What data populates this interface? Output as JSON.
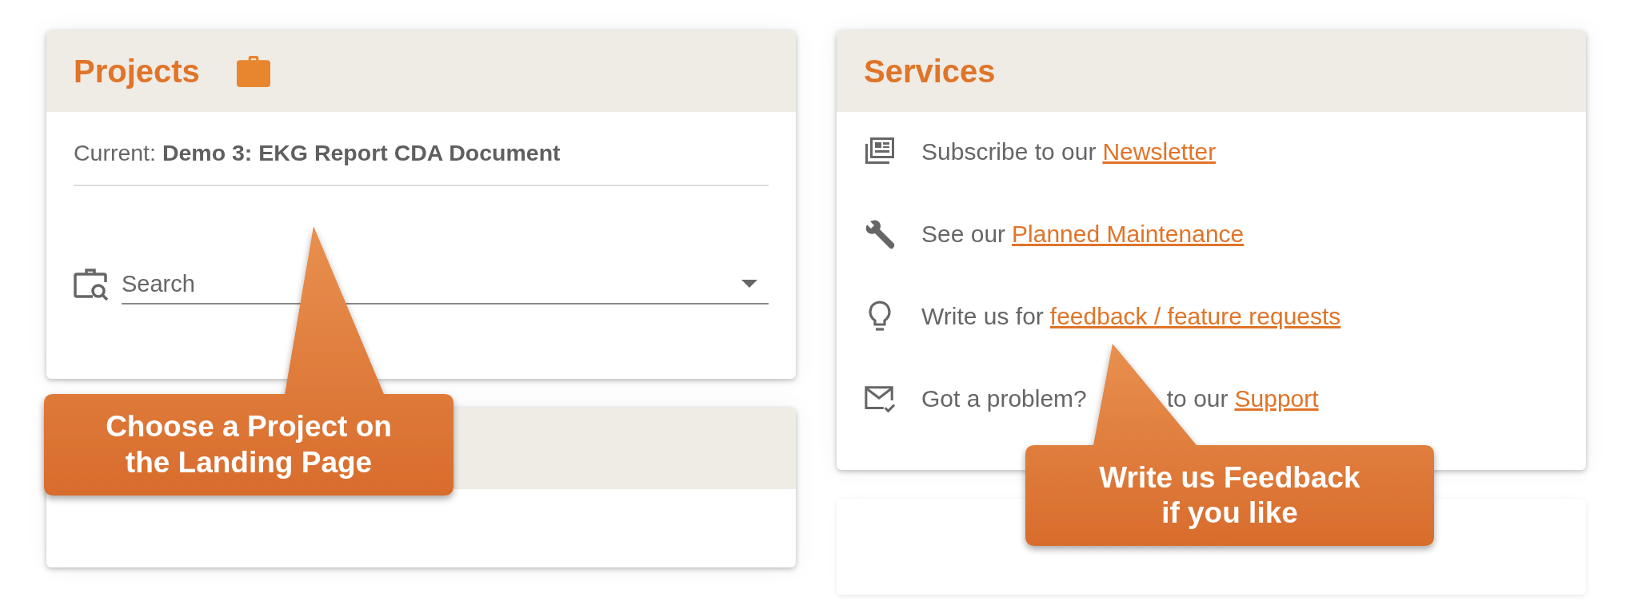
{
  "projects": {
    "title": "Projects",
    "current": "Current: **Demo 3: EKG Report CDA Document**",
    "search": {
      "placeholder": "Search"
    }
  },
  "services": {
    "title": "Services",
    "items": [
      {
        "kind": "newsletter",
        "text": "Subscribe to our",
        "link": "Newsletter"
      },
      {
        "kind": "maintenance",
        "text": "See our",
        "link": "Planned Maintenance"
      },
      {
        "kind": "idea",
        "text": "Write us for",
        "link": "feedback / feature requests"
      },
      {
        "kind": "support",
        "text": "Got a problem?",
        "text_after": "to our",
        "link": "Support"
      }
    ]
  },
  "callouts": [
    {
      "text": "Choose a Project on\nthe Landing Page"
    },
    {
      "text": "Write us Feedback\nif you like"
    }
  ]
}
